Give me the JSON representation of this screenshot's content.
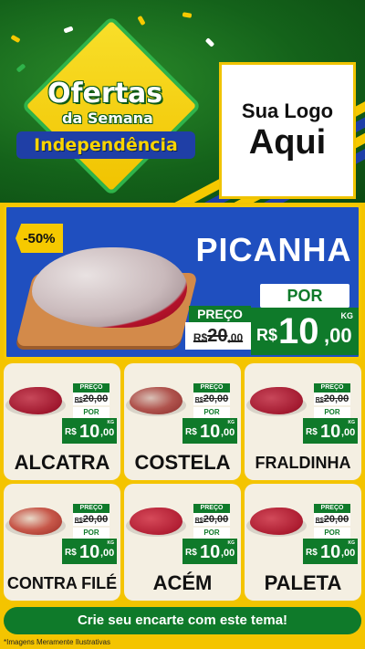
{
  "header": {
    "title_line1": "Ofertas",
    "title_line2": "da Semana",
    "title_line2_suffix": "da",
    "title_line3": "Independência",
    "logo_line1": "Sua Logo",
    "logo_line2": "Aqui"
  },
  "featured": {
    "discount": "-50%",
    "name": "PICANHA",
    "por_label": "POR",
    "preco_label": "PREÇO",
    "old_price_currency": "R$",
    "old_price_int": "20",
    "old_price_cents": ",00",
    "new_price_currency": "R$",
    "new_price_int": "10",
    "new_price_cents": ",00",
    "unit": "KG"
  },
  "products": [
    {
      "name": "ALCATRA",
      "preco_label": "PREÇO",
      "old_price": "20,00",
      "old_currency": "R$",
      "por_label": "POR",
      "currency": "R$",
      "price_int": "10",
      "price_cents": ",00",
      "unit": "KG"
    },
    {
      "name": "COSTELA",
      "preco_label": "PREÇO",
      "old_price": "20,00",
      "old_currency": "R$",
      "por_label": "POR",
      "currency": "R$",
      "price_int": "10",
      "price_cents": ",00",
      "unit": "KG"
    },
    {
      "name": "FRALDINHA",
      "preco_label": "PREÇO",
      "old_price": "20,00",
      "old_currency": "R$",
      "por_label": "POR",
      "currency": "R$",
      "price_int": "10",
      "price_cents": ",00",
      "unit": "KG"
    },
    {
      "name": "CONTRA FILÉ",
      "preco_label": "PREÇO",
      "old_price": "20,00",
      "old_currency": "R$",
      "por_label": "POR",
      "currency": "R$",
      "price_int": "10",
      "price_cents": ",00",
      "unit": "KG"
    },
    {
      "name": "ACÉM",
      "preco_label": "PREÇO",
      "old_price": "20,00",
      "old_currency": "R$",
      "por_label": "POR",
      "currency": "R$",
      "price_int": "10",
      "price_cents": ",00",
      "unit": "KG"
    },
    {
      "name": "PALETA",
      "preco_label": "PREÇO",
      "old_price": "20,00",
      "old_currency": "R$",
      "por_label": "POR",
      "currency": "R$",
      "price_int": "10",
      "price_cents": ",00",
      "unit": "KG"
    }
  ],
  "footer": {
    "cta": "Crie seu encarte com este tema!",
    "disclaimer": "*Imagens Meramente Ilustrativas"
  },
  "colors": {
    "green": "#0f7a2a",
    "blue": "#1f4fbf",
    "yellow": "#f6c900",
    "card": "#f4efe2"
  },
  "icons": [
    "meat-icon",
    "cutting-board-icon"
  ]
}
